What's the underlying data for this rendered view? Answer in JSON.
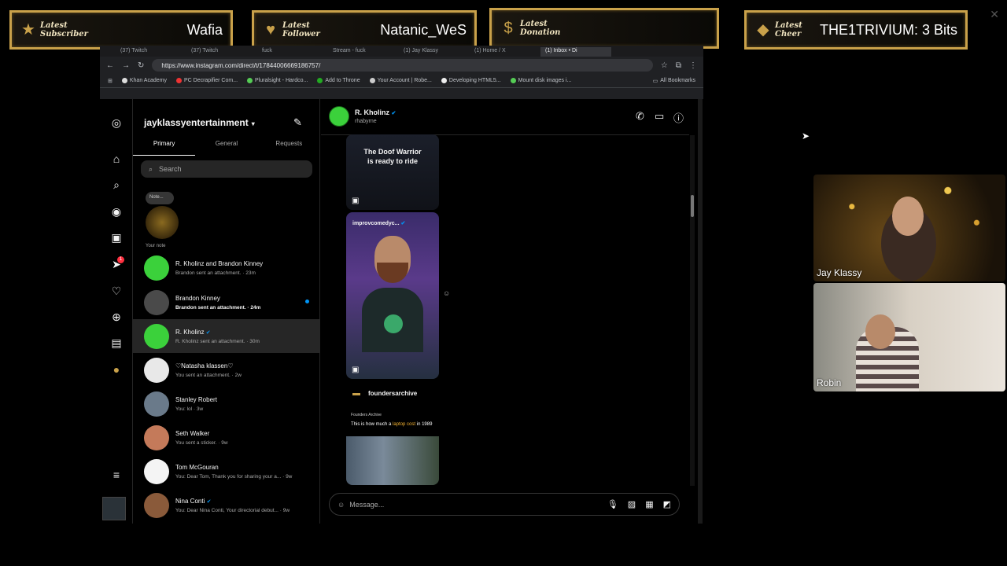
{
  "alerts": {
    "subscriber": {
      "label": "Latest Subscriber",
      "value": "Wafia"
    },
    "follower": {
      "label": "Latest Follower",
      "value": "Natanic_WeS"
    },
    "donation": {
      "label": "Latest Donation",
      "value": ""
    },
    "cheer": {
      "label": "Latest Cheer",
      "value": "THE1TRIVIUM: 3 Bits"
    }
  },
  "browser": {
    "tabs": [
      "(37) Twitch",
      "(37) Twitch",
      "fuck",
      "Stream - fuck",
      "(1) Jay Klassy",
      "(1) Home / X",
      "(1) Inbox • Di"
    ],
    "url": "https://www.instagram.com/direct/t/17844006669186757/",
    "bookmarks": [
      "Khan Academy",
      "PC Decrapifier Com...",
      "Pluralsight - Hardco...",
      "Add to Throne",
      "Your Account | Robe...",
      "Developing HTML5...",
      "Mount disk images i..."
    ],
    "all_bookmarks": "All Bookmarks"
  },
  "inbox": {
    "account": "jayklassyentertainment",
    "tabs": [
      "Primary",
      "General",
      "Requests"
    ],
    "search_placeholder": "Search",
    "note_bubble": "Note...",
    "note_caption": "Your note",
    "conversations": [
      {
        "name": "R. Kholinz and Brandon Kinney",
        "sub": "Brandon sent an attachment. · 23m",
        "color": "#3bd13b",
        "unread": false
      },
      {
        "name": "Brandon Kinney",
        "sub": "Brandon sent an attachment. · 24m",
        "color": "#4a4a4a",
        "unread": true
      },
      {
        "name": "R. Kholinz",
        "sub": "R. Kholinz sent an attachment. · 30m",
        "color": "#3bd13b",
        "unread": false
      },
      {
        "name": "♡Natasha klassen♡",
        "sub": "You sent an attachment. · 2w",
        "color": "#e8e8e8",
        "unread": false
      },
      {
        "name": "Stanley Robert",
        "sub": "You: lol · 3w",
        "color": "#6a7a8a",
        "unread": false
      },
      {
        "name": "Seth Walker",
        "sub": "You sent a sticker. · 9w",
        "color": "#c47a5a",
        "unread": false
      },
      {
        "name": "Tom McGouran",
        "sub": "You: Dear Tom, Thank you for sharing your a... · 9w",
        "color": "#f4f4f4",
        "unread": false
      },
      {
        "name": "Nina Conti",
        "sub": "You: Dear Nina Conti, Your directorial debut... · 9w",
        "color": "#8a5a3a",
        "unread": false
      }
    ]
  },
  "chat": {
    "name": "R. Kholinz",
    "username": "rhabyrne",
    "reel1_caption_line1": "The Doof Warrior",
    "reel1_caption_line2": "is ready to ride",
    "reel2_account": "improvcomedyc...",
    "shared_account": "foundersarchive",
    "reel3_source": "Founders Archive",
    "reel3_title_pre": "This is how much a ",
    "reel3_title_hl": "laptop cost",
    "reel3_title_post": " in 1989",
    "message_placeholder": "Message..."
  },
  "cams": {
    "cam1": "Jay Klassy",
    "cam2": "Robin"
  },
  "colors": {
    "accent_gold": "#c9a14a",
    "verified_blue": "#0095f6",
    "notification_red": "#ff3040"
  }
}
